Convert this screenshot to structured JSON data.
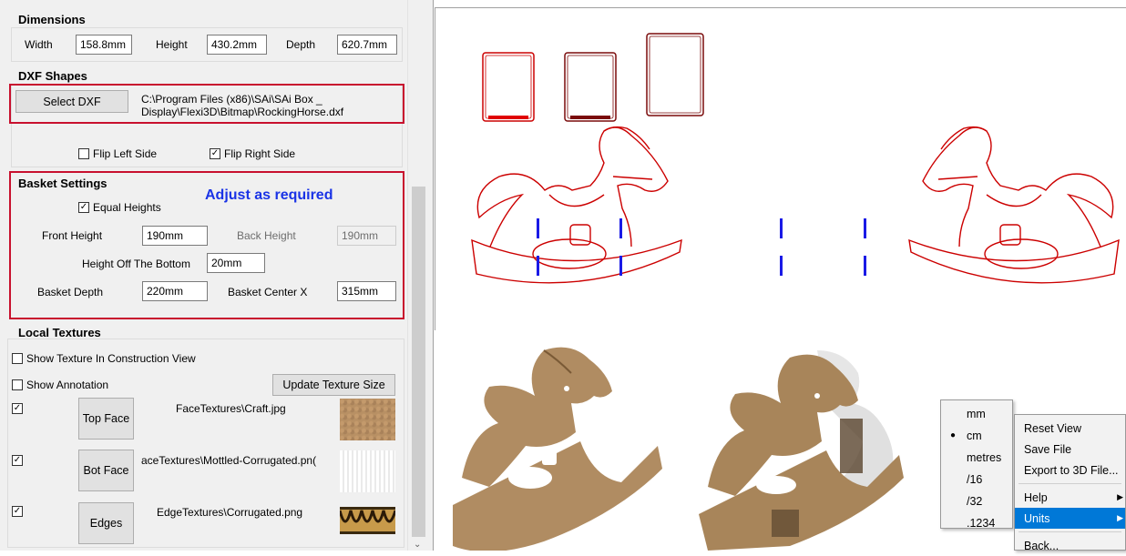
{
  "dimensions": {
    "header": "Dimensions",
    "width_label": "Width",
    "width_value": "158.8mm",
    "height_label": "Height",
    "height_value": "430.2mm",
    "depth_label": "Depth",
    "depth_value": "620.7mm"
  },
  "dxf": {
    "header": "DXF Shapes",
    "select_button": "Select DXF",
    "path_line1": "C:\\Program Files (x86)\\SAi\\SAi Box _",
    "path_line2": "Display\\Flexi3D\\Bitmap\\RockingHorse.dxf",
    "flip_left": "Flip Left Side",
    "flip_left_checked": false,
    "flip_right": "Flip Right Side",
    "flip_right_checked": true
  },
  "basket": {
    "header": "Basket Settings",
    "annotation": "Adjust as required",
    "annotation_color": "#1a33e6",
    "equal_heights": "Equal Heights",
    "equal_heights_checked": true,
    "front_height_label": "Front Height",
    "front_height_value": "190mm",
    "back_height_label": "Back Height",
    "back_height_value": "190mm",
    "off_bottom_label": "Height Off The Bottom",
    "off_bottom_value": "20mm",
    "depth_label": "Basket Depth",
    "depth_value": "220mm",
    "center_label": "Basket Center X",
    "center_value": "315mm"
  },
  "textures": {
    "header": "Local Textures",
    "show_construction": "Show Texture In Construction View",
    "show_annotation": "Show Annotation",
    "update_button": "Update Texture Size",
    "rows": [
      {
        "checked": true,
        "button": "Top Face",
        "file": "FaceTextures\\Craft.jpg"
      },
      {
        "checked": true,
        "button": "Bot Face",
        "file": "aceTextures\\Mottled-Corrugated.pn("
      },
      {
        "checked": true,
        "button": "Edges",
        "file": "EdgeTextures\\Corrugated.png"
      }
    ]
  },
  "units_menu": {
    "items": [
      "mm",
      "cm",
      "metres",
      "/16",
      "/32",
      ".1234"
    ],
    "selected": "cm"
  },
  "context_menu": {
    "items": [
      "Reset View",
      "Save File",
      "Export to 3D File...",
      "Help",
      "Units",
      "Back..."
    ],
    "highlighted": "Units"
  },
  "colors": {
    "outline_red": "#cc0000",
    "dark_red": "#7a0a0a",
    "slot_blue": "#1a1ae6",
    "cardboard": "#b08c62",
    "highlight_blue": "#0078d7"
  }
}
